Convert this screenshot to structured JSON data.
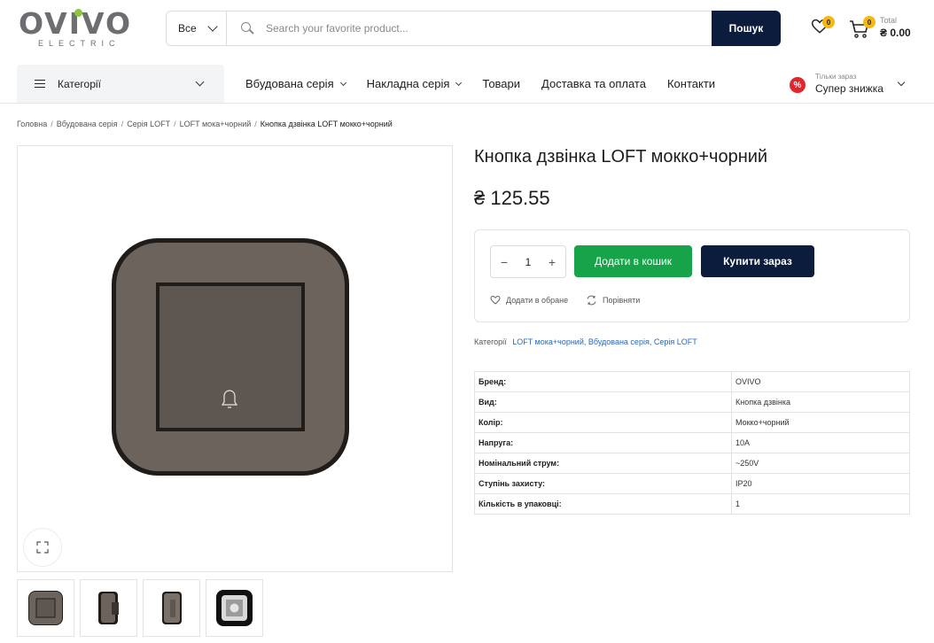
{
  "logo": {
    "main": "OVIVO",
    "sub": "ELECTRIC"
  },
  "search": {
    "category": "Все",
    "placeholder": "Search your favorite product...",
    "button": "Пошук"
  },
  "header": {
    "wishlist_count": "0",
    "cart_count": "0",
    "cart_total_label": "Total",
    "cart_total": "₴ 0.00"
  },
  "nav": {
    "categories_label": "Категорії",
    "items": [
      {
        "label": "Вбудована серія",
        "dropdown": true
      },
      {
        "label": "Накладна серія",
        "dropdown": true
      },
      {
        "label": "Товари",
        "dropdown": false
      },
      {
        "label": "Доставка та оплата",
        "dropdown": false
      },
      {
        "label": "Контакти",
        "dropdown": false
      }
    ],
    "promo_small": "Тільки зараз",
    "promo_big": "Супер знижка",
    "promo_icon": "%"
  },
  "breadcrumb": {
    "items": [
      "Головна",
      "Вбудована серія",
      "Серія LOFT",
      "LOFT мока+чорний"
    ],
    "current": "Кнопка дзвінка LOFT мокко+чорний"
  },
  "product": {
    "title": "Кнопка дзвінка LOFT мокко+чорний",
    "price": "₴ 125.55",
    "quantity": "1",
    "add_to_cart": "Додати в кошик",
    "buy_now": "Купити зараз",
    "wishlist": "Додати в обране",
    "compare": "Порівняти",
    "categories_label": "Категорії",
    "categories_value": "LOFT мока+чорний, Вбудована серія, Серія LOFT",
    "colors": {
      "frame": "#1f1c1a",
      "body": "#6c635c",
      "key": "#5e5751",
      "green": "#17a34a",
      "navy": "#0b1c3d"
    }
  },
  "specs": [
    {
      "key": "Бренд:",
      "value": "OVIVO"
    },
    {
      "key": "Вид:",
      "value": "Кнопка дзвінка"
    },
    {
      "key": "Колір:",
      "value": "Мокко+чорний"
    },
    {
      "key": "Напруга:",
      "value": "10A"
    },
    {
      "key": "Номінальний струм:",
      "value": "~250V"
    },
    {
      "key": "Ступінь захисту:",
      "value": "IP20"
    },
    {
      "key": "Кількість в упаковці:",
      "value": "1"
    }
  ]
}
